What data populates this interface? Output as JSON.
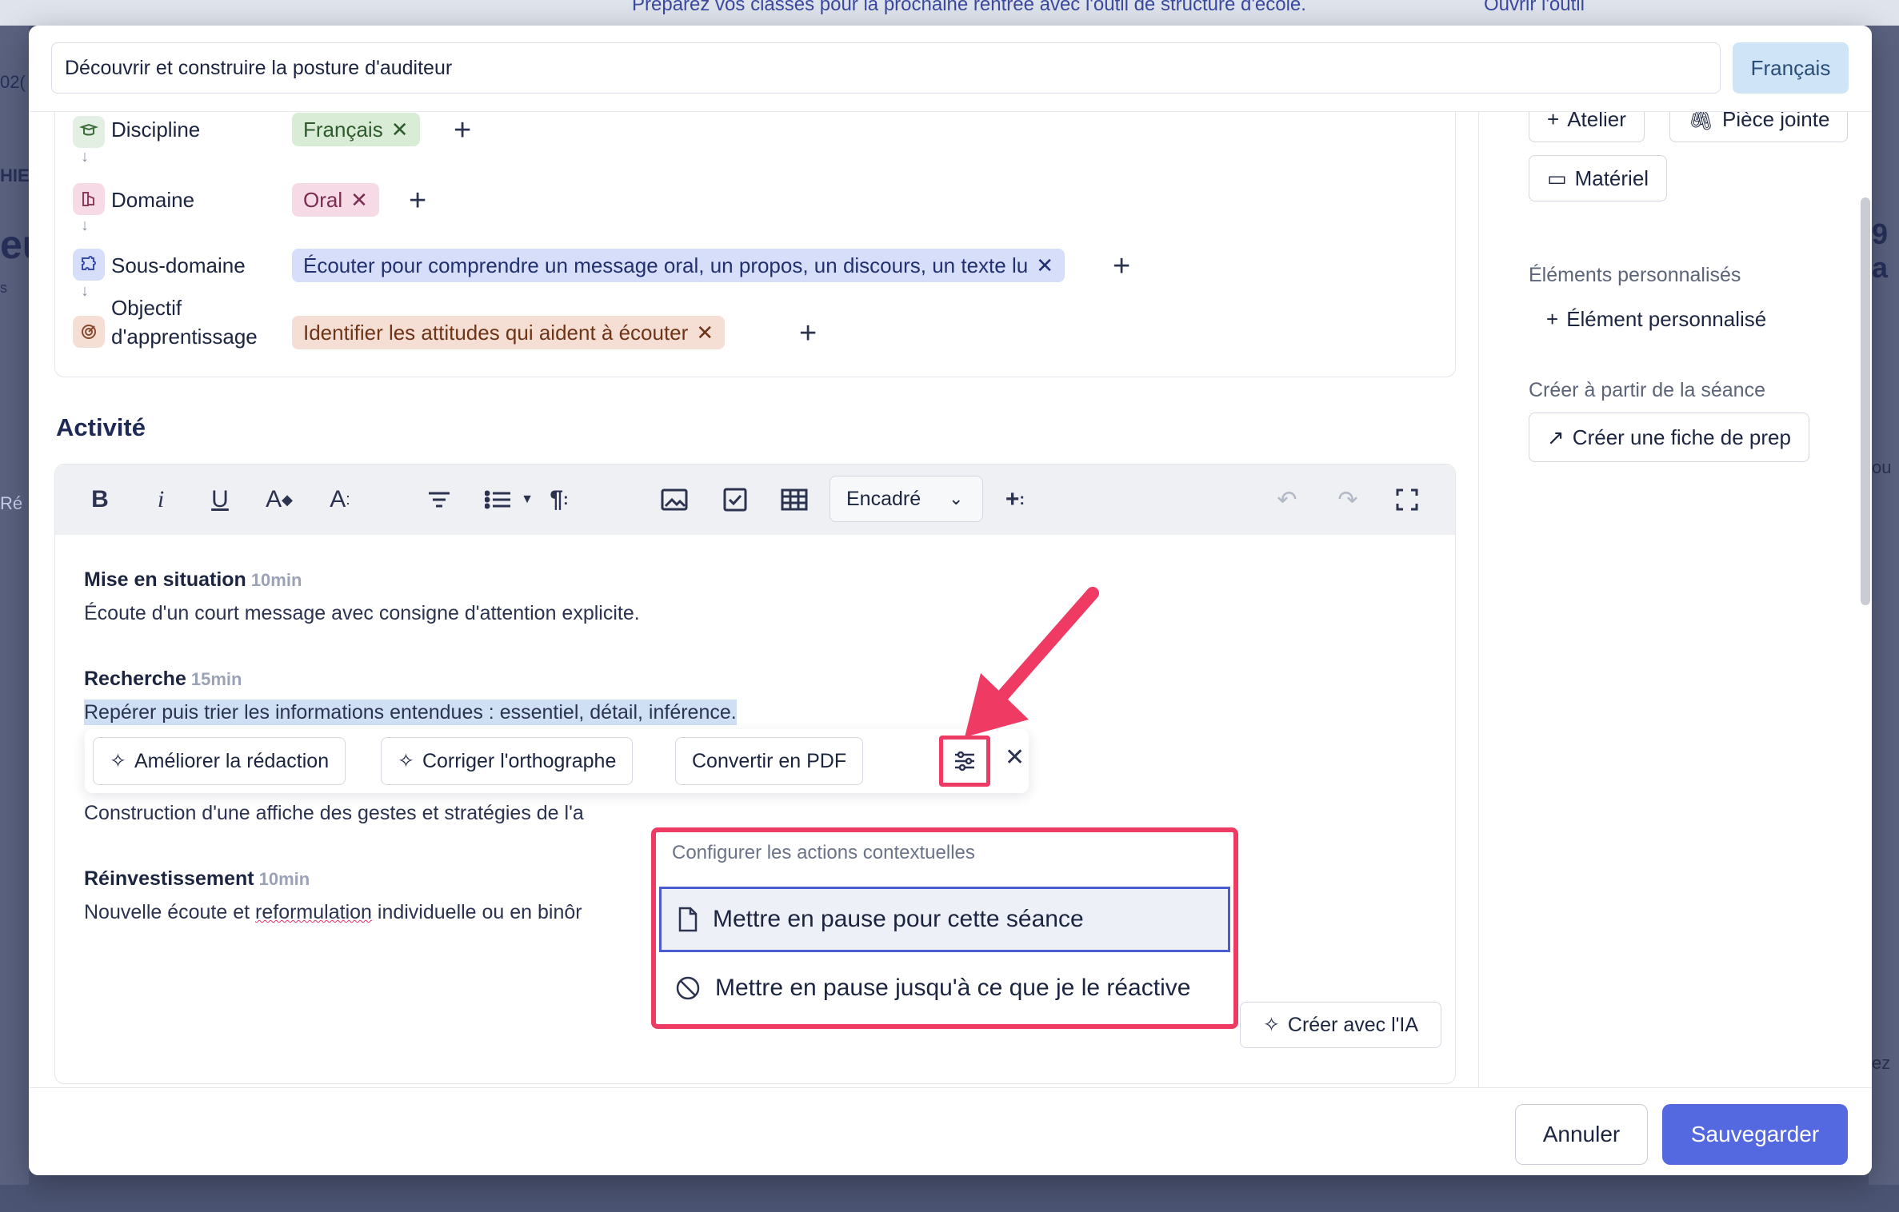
{
  "background": {
    "banner_text": "Préparez vos classes pour la prochaine rentrée avec l'outil de structure d'école.",
    "banner_link": "Ouvrir l'outil",
    "left_fragments": [
      "02(",
      "HIE",
      "eu",
      "s",
      "Ré"
    ],
    "right_fragments": [
      "9 a",
      "ou",
      "ez"
    ]
  },
  "title_input": {
    "value": "Découvrir et construire la posture d'auditeur"
  },
  "lang_badge": "Français",
  "taxonomy": [
    {
      "label": "Discipline",
      "chip": "Français",
      "icon": "book-icon"
    },
    {
      "label": "Domaine",
      "chip": "Oral",
      "icon": "speech-icon"
    },
    {
      "label": "Sous-domaine",
      "chip": "Écouter pour comprendre un message oral, un propos, un discours, un texte lu",
      "icon": "puzzle-icon"
    },
    {
      "label": "Objectif d'apprentissage",
      "chip": "Identifier les attitudes qui aident à écouter",
      "icon": "target-icon"
    }
  ],
  "section_title": "Activité",
  "toolbar": {
    "block_select": "Encadré"
  },
  "editor": {
    "blocks": [
      {
        "title": "Mise en situation",
        "duration": "10min",
        "text": "Écoute d'un court message avec consigne d'attention explicite."
      },
      {
        "title": "Recherche",
        "duration": "15min",
        "text": "Repérer puis trier les informations entendues : essentiel, détail, inférence."
      },
      {
        "title": "",
        "duration": "",
        "text": "Construction d'une affiche des gestes et stratégies de l'a"
      },
      {
        "title": "Réinvestissement",
        "duration": "10min",
        "text_a": "Nouvelle écoute et ",
        "text_b": "reformulation",
        "text_c": " individuelle ou en binôr"
      }
    ]
  },
  "context_bar": {
    "improve": "Améliorer la rédaction",
    "spell": "Corriger l'orthographe",
    "pdf": "Convertir en PDF"
  },
  "dropdown": {
    "header": "Configurer les actions contextuelles",
    "item1": "Mettre en pause pour cette séance",
    "item2": "Mettre en pause jusqu'à ce que je le réactive"
  },
  "create_ai": "Créer avec l'IA",
  "right": {
    "atelier": "Atelier",
    "piece_jointe": "Pièce jointe",
    "materiel": "Matériel",
    "custom_label": "Éléments personnalisés",
    "custom_link": "Élément personnalisé",
    "create_label": "Créer à partir de la séance",
    "create_btn": "Créer une fiche de prep"
  },
  "footer": {
    "cancel": "Annuler",
    "save": "Sauvegarder"
  },
  "colors": {
    "accent": "#5469e0",
    "highlight": "#ef3a64",
    "chip_discipline": "#d8ecd6",
    "chip_domaine": "#f6dbe6",
    "chip_sousdomaine": "#d7defa",
    "chip_objectif": "#f5dfd5"
  }
}
